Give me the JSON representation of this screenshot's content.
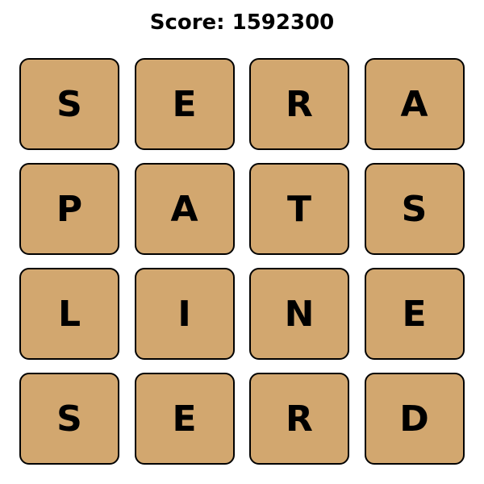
{
  "score_text": "Score: 1592300",
  "colors": {
    "tile_fill": "#d2a76f",
    "tile_border": "#000000",
    "text": "#000000",
    "background": "#ffffff"
  },
  "board": {
    "rows": [
      [
        "S",
        "E",
        "R",
        "A"
      ],
      [
        "P",
        "A",
        "T",
        "S"
      ],
      [
        "L",
        "I",
        "N",
        "E"
      ],
      [
        "S",
        "E",
        "R",
        "D"
      ]
    ]
  }
}
